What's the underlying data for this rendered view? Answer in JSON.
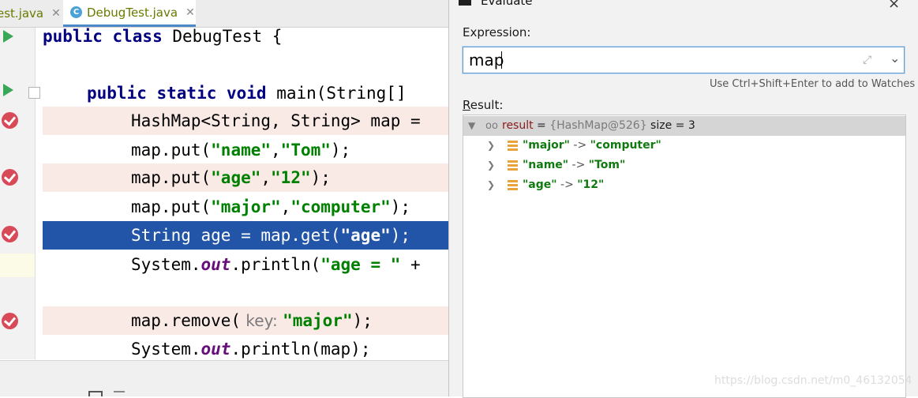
{
  "tabs": [
    {
      "name": "est.java"
    },
    {
      "name": "DebugTest.java"
    }
  ],
  "code": {
    "l1": {
      "kw": "public class",
      "rest": " DebugTest {"
    },
    "l3": {
      "kw": "public static void",
      "rest": " main(String[]"
    },
    "l4": {
      "text": "HashMap<String, String> map ="
    },
    "l5": {
      "a": "map.put(",
      "s1": "\"name\"",
      "b": ",",
      "s2": "\"Tom\"",
      "c": ");"
    },
    "l6": {
      "a": "map.put(",
      "s1": "\"age\"",
      "b": ",",
      "s2": "\"12\"",
      "c": ");"
    },
    "l7": {
      "a": "map.put(",
      "s1": "\"major\"",
      "b": ",",
      "s2": "\"computer\"",
      "c": ");"
    },
    "l8": {
      "a": "String age = map.get(",
      "s1": "\"age\"",
      "c": ");"
    },
    "l9": {
      "a": "System.",
      "fld": "out",
      "b": ".println(",
      "s1": "\"age = \"",
      "c": " +"
    },
    "l11": {
      "a": "map.remove(",
      "hint": " key: ",
      "s1": "\"major\"",
      "c": ");"
    },
    "l12": {
      "a": "System.",
      "fld": "out",
      "b": ".println(map);"
    }
  },
  "dialog": {
    "title": "Evaluate",
    "close": "×",
    "expression_label": "Expression:",
    "expression_value": "map",
    "hint": "Use Ctrl+Shift+Enter to add to Watches",
    "result_label_u": "R",
    "result_label_rest": "esult:",
    "result": {
      "name": "result",
      "eq": " = ",
      "type": "{HashMap@526}",
      "size": "  size = 3",
      "entries": [
        {
          "key": "\"major\"",
          "arrow": " -> ",
          "value": "\"computer\""
        },
        {
          "key": "\"name\"",
          "arrow": " -> ",
          "value": "\"Tom\""
        },
        {
          "key": "\"age\"",
          "arrow": " -> ",
          "value": "\"12\""
        }
      ]
    }
  },
  "watermark": "https://blog.csdn.net/m0_46132054"
}
